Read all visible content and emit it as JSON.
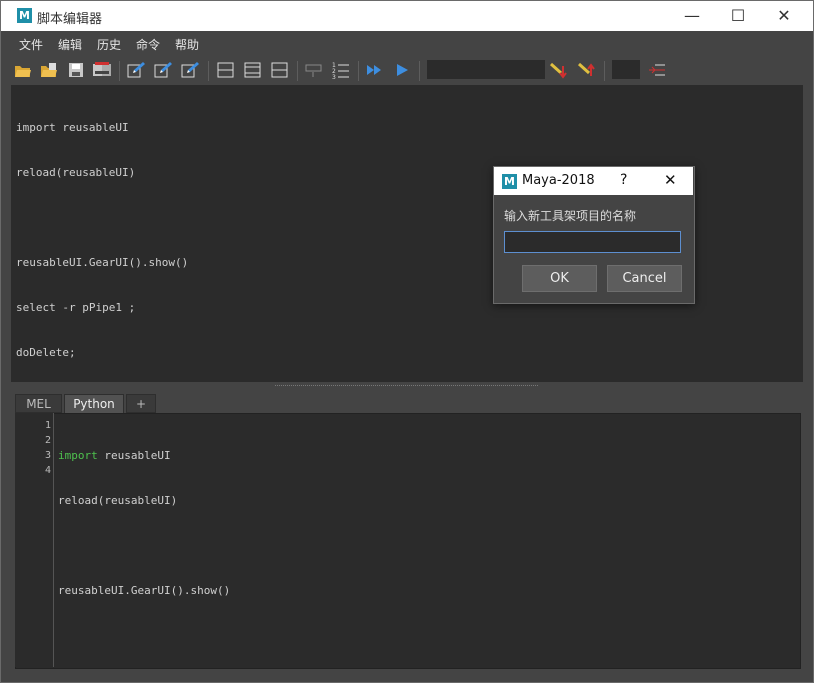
{
  "window": {
    "title": "脚本编辑器",
    "controls": {
      "minimize": "—",
      "maximize": "☐",
      "close": "✕"
    }
  },
  "menubar": [
    "文件",
    "编辑",
    "历史",
    "命令",
    "帮助"
  ],
  "output_lines": [
    "import reusableUI",
    "reload(reusableUI)",
    "",
    "reusableUI.GearUI().show()",
    "select -r pPipe1 ;",
    "doDelete;"
  ],
  "tabs": [
    {
      "label": "MEL",
      "active": false
    },
    {
      "label": "Python",
      "active": true
    },
    {
      "label": "+",
      "active": false
    }
  ],
  "editor": {
    "line_numbers": [
      "1",
      "2",
      "3",
      "4"
    ],
    "lines": [
      {
        "kw": "import",
        "rest": " reusableUI"
      },
      {
        "kw": "",
        "rest": "reload(reusableUI)"
      },
      {
        "kw": "",
        "rest": ""
      },
      {
        "kw": "",
        "rest": "reusableUI.GearUI().show()"
      }
    ]
  },
  "dialog": {
    "title": "Maya-2018",
    "help": "?",
    "close": "✕",
    "prompt": "输入新工具架项目的名称",
    "input_value": "",
    "ok_label": "OK",
    "cancel_label": "Cancel"
  },
  "logo_letter": "M",
  "colors": {
    "keyword": "#4ec24e",
    "accent_blue": "#3d8ee0",
    "focus_border": "#5d8fd0"
  }
}
